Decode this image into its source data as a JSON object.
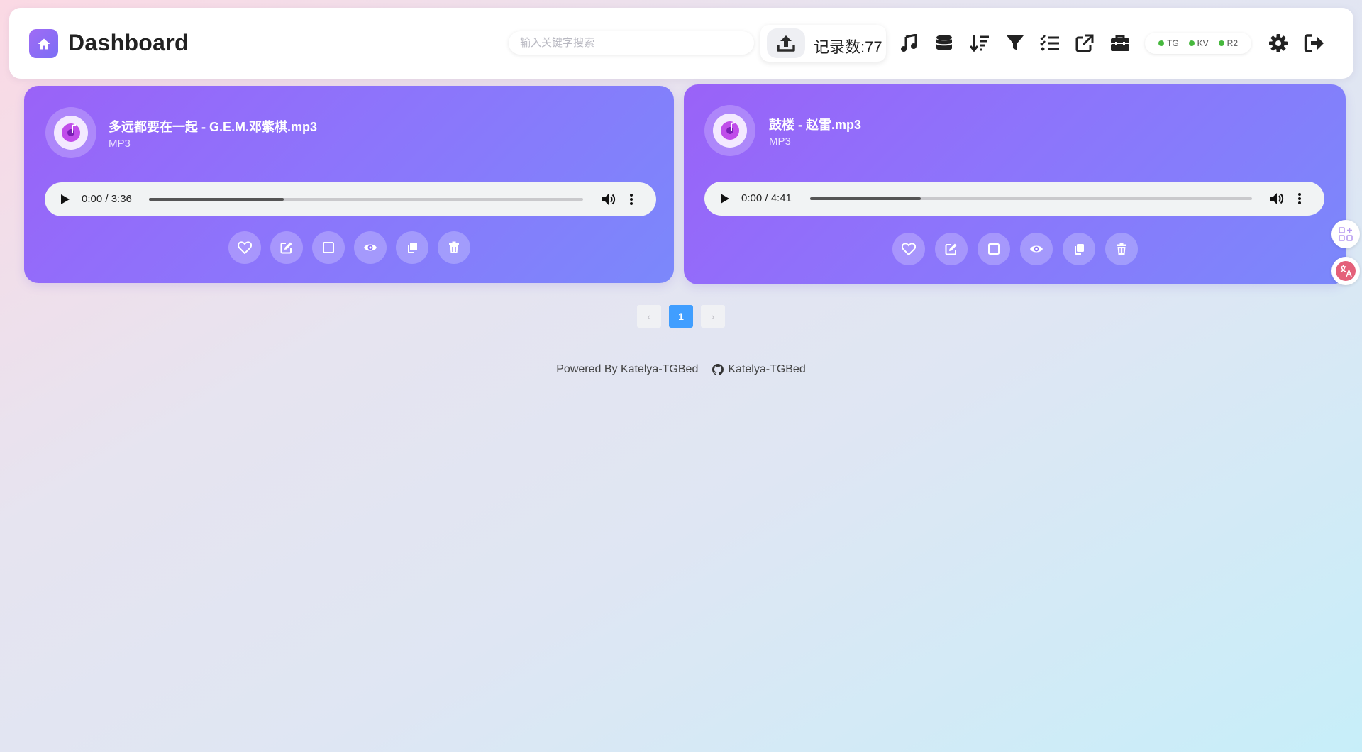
{
  "header": {
    "title": "Dashboard",
    "search_placeholder": "输入关键字搜索",
    "record_count": "记录数:77",
    "status": [
      {
        "label": "TG",
        "color": "#46b83d"
      },
      {
        "label": "KV",
        "color": "#46b83d"
      },
      {
        "label": "R2",
        "color": "#46b83d"
      }
    ],
    "toolbar_icons": [
      "music-icon",
      "database-icon",
      "sort-icon",
      "filter-icon",
      "checklist-icon",
      "external-link-icon",
      "toolbox-icon",
      "gear-icon",
      "logout-icon"
    ]
  },
  "cards": [
    {
      "name": "多远都要在一起 - G.E.M.邓紫棋.mp3",
      "type": "MP3",
      "time": "0:00 / 3:36",
      "progress": 0.31
    },
    {
      "name": "鼓楼 - 赵雷.mp3",
      "type": "MP3",
      "time": "0:00 / 4:41",
      "progress": 0.25
    }
  ],
  "card_actions": [
    "heart-icon",
    "edit-icon",
    "select-checkbox-icon",
    "eye-icon",
    "copy-icon",
    "trash-icon"
  ],
  "pagination": {
    "prev": "‹",
    "current": "1",
    "next": "›"
  },
  "footer": {
    "powered_by": "Powered By Katelya-TGBed",
    "github_link": "Katelya-TGBed"
  },
  "colors": {
    "accent": "#409eff",
    "card_gradient_start": "#9a62f8",
    "card_gradient_end": "#7b88fb",
    "status_dot": "#46b83d"
  }
}
